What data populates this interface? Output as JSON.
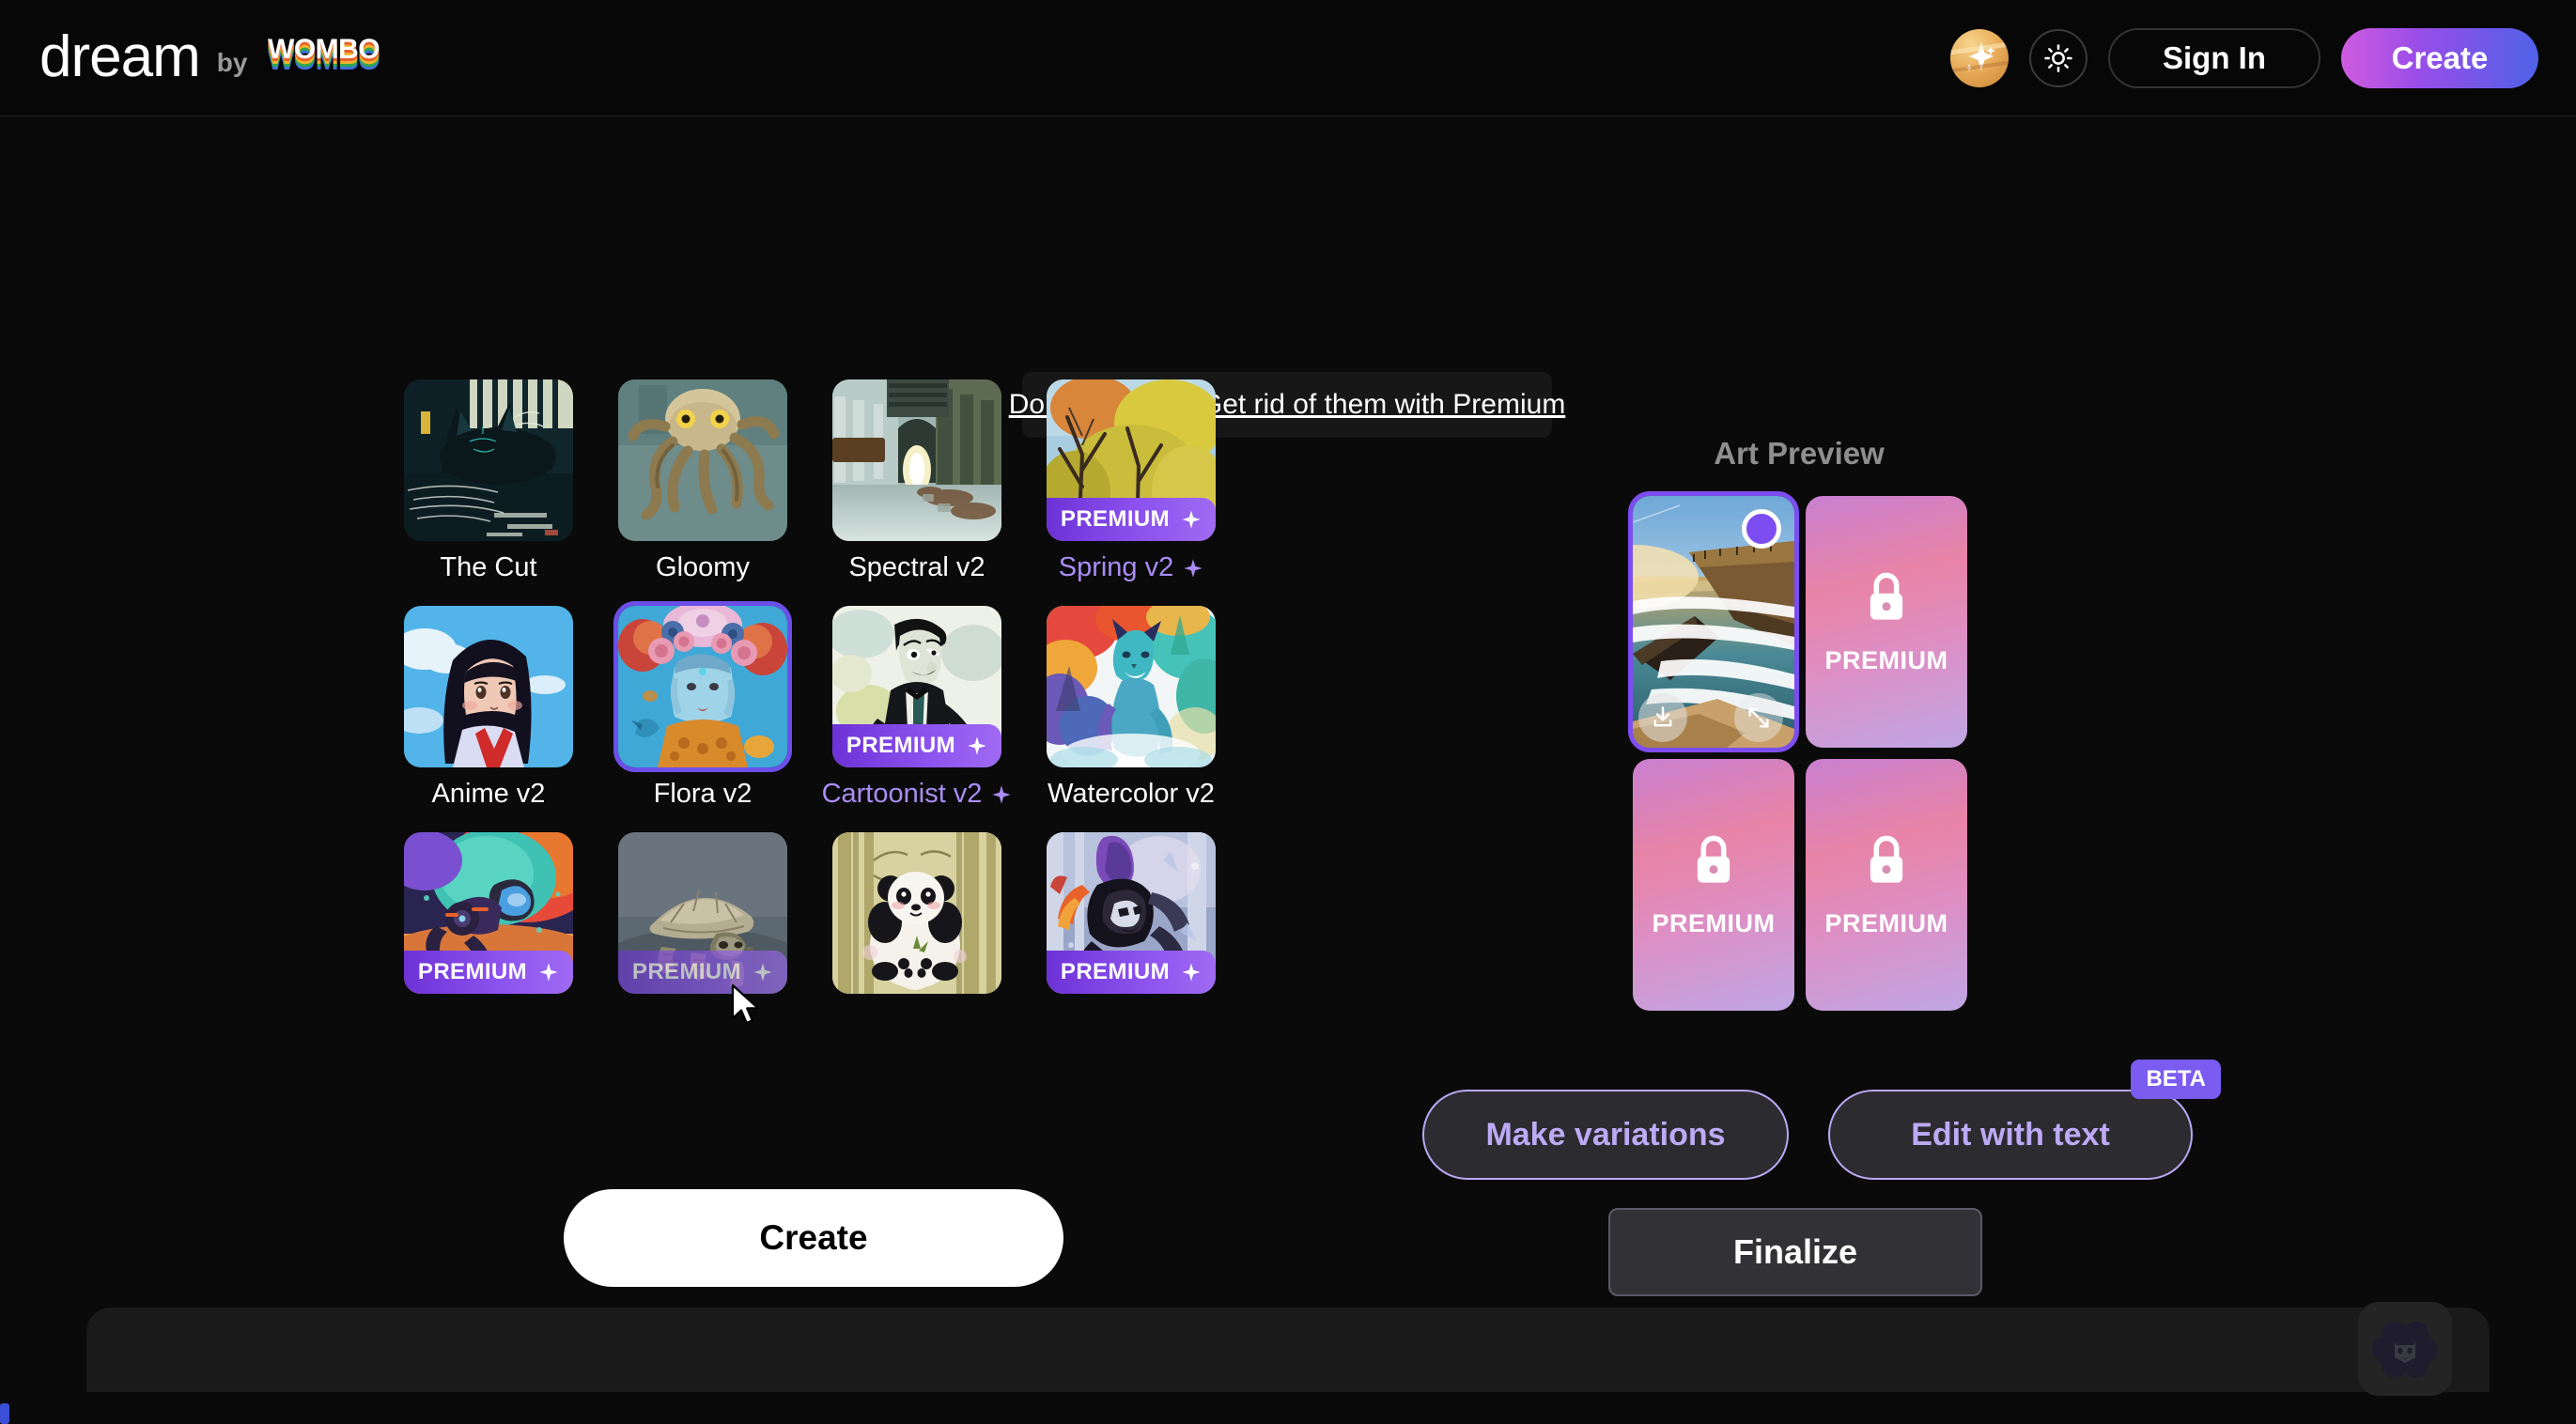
{
  "header": {
    "brand_name": "dream",
    "brand_by": "by",
    "brand_partner": "WOMBO",
    "avatar_icon": "sparkle-avatar-icon",
    "theme_icon": "sun-icon",
    "signin_label": "Sign In",
    "create_label": "Create",
    "create_gradient_from": "#cf5ce0",
    "create_gradient_to": "#4f62e8"
  },
  "ad_banner": {
    "text": "Don't like ads? Get rid of them with Premium"
  },
  "styles": {
    "selected": "Flora v2",
    "premium_badge_label": "PREMIUM",
    "items": [
      {
        "label": "The Cut",
        "premium": false
      },
      {
        "label": "Gloomy",
        "premium": false
      },
      {
        "label": "Spectral v2",
        "premium": false
      },
      {
        "label": "Spring v2",
        "premium": true
      },
      {
        "label": "Anime v2",
        "premium": false
      },
      {
        "label": "Flora v2",
        "premium": false
      },
      {
        "label": "Cartoonist v2",
        "premium": true
      },
      {
        "label": "Watercolor v2",
        "premium": false
      },
      {
        "label": "",
        "premium": true
      },
      {
        "label": "",
        "premium": true
      },
      {
        "label": "",
        "premium": false
      },
      {
        "label": "",
        "premium": true
      }
    ]
  },
  "create_button": {
    "label": "Create"
  },
  "art_preview": {
    "title": "Art Preview",
    "premium_label": "PREMIUM",
    "lock_icon": "lock-icon",
    "download_icon": "download-icon",
    "expand_icon": "expand-icon",
    "selection_color": "#7c4df0",
    "tiles": [
      {
        "type": "image",
        "selected": true
      },
      {
        "type": "premium",
        "selected": false
      },
      {
        "type": "premium",
        "selected": false
      },
      {
        "type": "premium",
        "selected": false
      }
    ]
  },
  "actions": {
    "make_variations_label": "Make variations",
    "edit_with_text_label": "Edit with text",
    "beta_label": "BETA",
    "finalize_label": "Finalize"
  },
  "chat_widget": {
    "icon": "wombo-flower-face-icon"
  }
}
